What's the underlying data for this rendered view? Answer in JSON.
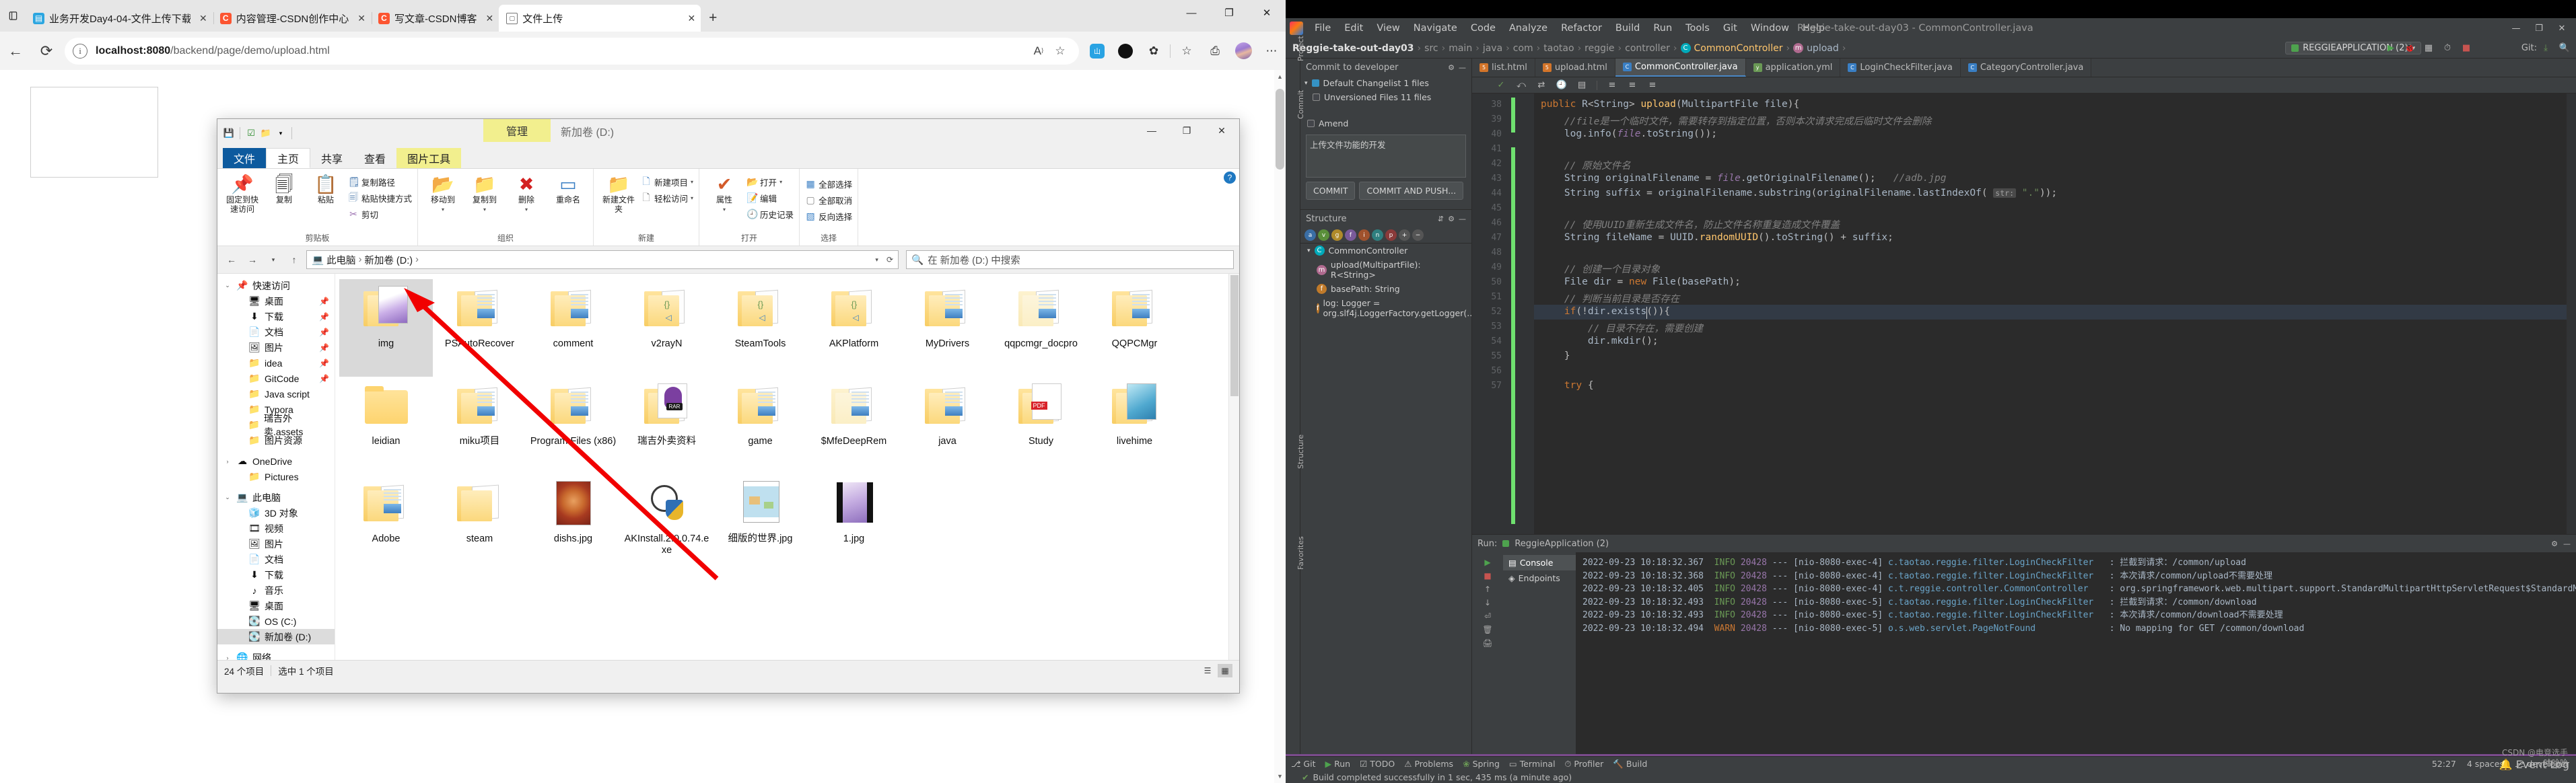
{
  "browser": {
    "app": "Microsoft Edge",
    "tabs": [
      {
        "title": "业务开发Day4-04-文件上传下载",
        "favicon": "blue-doc-icon",
        "active": false
      },
      {
        "title": "内容管理-CSDN创作中心",
        "favicon": "csdn-icon",
        "active": false
      },
      {
        "title": "写文章-CSDN博客",
        "favicon": "csdn-icon",
        "active": false
      },
      {
        "title": "文件上传",
        "favicon": "page-icon",
        "active": true
      }
    ],
    "new_tab_label": "+",
    "close_label": "✕",
    "url_host": "localhost:8080",
    "url_path": "/backend/page/demo/upload.html",
    "window_controls": {
      "minimize": "—",
      "restore": "❐",
      "close": "✕"
    },
    "toolbar_icons": [
      "read-aloud-icon",
      "add-favorite-icon",
      "extension-blue-icon",
      "extension-black-icon",
      "collections-icon",
      "favorites-icon",
      "add-collection-icon",
      "profile-avatar",
      "settings-more-icon"
    ]
  },
  "explorer": {
    "quick_access_icons": [
      "save-icon",
      "properties-icon",
      "new-folder-icon",
      "customize-dropdown-icon"
    ],
    "context_tab": "管理",
    "context_label": "新加卷 (D:)",
    "window_controls": {
      "minimize": "—",
      "maximize": "❐",
      "close": "✕"
    },
    "tabs": [
      {
        "label": "文件",
        "kind": "file"
      },
      {
        "label": "主页",
        "kind": "selected"
      },
      {
        "label": "共享",
        "kind": "normal"
      },
      {
        "label": "查看",
        "kind": "normal"
      },
      {
        "label": "图片工具",
        "kind": "context"
      }
    ],
    "ribbon": [
      {
        "title": "剪贴板",
        "big": [
          {
            "label": "固定到快速访问",
            "glyph": "📌"
          },
          {
            "label": "复制",
            "glyph": "📄"
          },
          {
            "label": "粘贴",
            "glyph": "📋"
          }
        ],
        "small": [
          {
            "label": "复制路径",
            "glyph": "🗐"
          },
          {
            "label": "粘贴快捷方式",
            "glyph": "🗒"
          },
          {
            "label": "剪切",
            "glyph": "✂"
          }
        ]
      },
      {
        "title": "组织",
        "big": [
          {
            "label": "移动到",
            "glyph": "📁",
            "dropdown": true
          },
          {
            "label": "复制到",
            "glyph": "📁",
            "dropdown": true
          },
          {
            "label": "删除",
            "glyph": "✖",
            "dropdown": true
          },
          {
            "label": "重命名",
            "glyph": "▭"
          }
        ],
        "small": []
      },
      {
        "title": "新建",
        "big": [
          {
            "label": "新建文件夹",
            "glyph": "📁"
          }
        ],
        "small": [
          {
            "label": "新建项目",
            "glyph": "🗋",
            "dropdown": true
          },
          {
            "label": "轻松访问",
            "glyph": "🗋",
            "dropdown": true
          }
        ]
      },
      {
        "title": "打开",
        "big": [
          {
            "label": "属性",
            "glyph": "✔",
            "dropdown": true
          }
        ],
        "small": [
          {
            "label": "打开",
            "glyph": "📂",
            "dropdown": true
          },
          {
            "label": "编辑",
            "glyph": "📝"
          },
          {
            "label": "历史记录",
            "glyph": "🕘"
          }
        ]
      },
      {
        "title": "选择",
        "big": [],
        "small": [
          {
            "label": "全部选择",
            "glyph": "▦"
          },
          {
            "label": "全部取消",
            "glyph": "▢"
          },
          {
            "label": "反向选择",
            "glyph": "▧"
          }
        ]
      }
    ],
    "address_buttons": [
      "back-icon",
      "forward-icon",
      "up-icon"
    ],
    "address_path": [
      "此电脑",
      "新加卷 (D:)"
    ],
    "search_placeholder": "在 新加卷 (D:) 中搜索",
    "nav_tree": [
      {
        "label": "快速访问",
        "icon": "pin-icon",
        "level": 1,
        "twisty": "⌄",
        "pinned": false
      },
      {
        "label": "桌面",
        "icon": "desktop-icon",
        "level": 2,
        "pinned": true
      },
      {
        "label": "下载",
        "icon": "download-icon",
        "level": 2,
        "pinned": true
      },
      {
        "label": "文档",
        "icon": "documents-icon",
        "level": 2,
        "pinned": true
      },
      {
        "label": "图片",
        "icon": "pictures-icon",
        "level": 2,
        "pinned": true
      },
      {
        "label": "idea",
        "icon": "folder-icon",
        "level": 2,
        "pinned": true
      },
      {
        "label": "GitCode",
        "icon": "folder-icon",
        "level": 2,
        "pinned": true
      },
      {
        "label": "Java script",
        "icon": "folder-icon",
        "level": 2,
        "pinned": false
      },
      {
        "label": "Typora",
        "icon": "folder-icon",
        "level": 2,
        "pinned": false
      },
      {
        "label": "瑞吉外卖.assets",
        "icon": "folder-icon",
        "level": 2,
        "pinned": false
      },
      {
        "label": "图片资源",
        "icon": "folder-icon",
        "level": 2,
        "pinned": false
      },
      {
        "label": "",
        "icon": "",
        "level": 0,
        "gap": true
      },
      {
        "label": "OneDrive",
        "icon": "cloud-icon",
        "level": 1,
        "twisty": "›"
      },
      {
        "label": "Pictures",
        "icon": "folder-icon",
        "level": 2
      },
      {
        "label": "",
        "icon": "",
        "level": 0,
        "gap": true
      },
      {
        "label": "此电脑",
        "icon": "this-pc-icon",
        "level": 1,
        "twisty": "⌄"
      },
      {
        "label": "3D 对象",
        "icon": "3d-objects-icon",
        "level": 2
      },
      {
        "label": "视频",
        "icon": "videos-icon",
        "level": 2
      },
      {
        "label": "图片",
        "icon": "pictures-icon",
        "level": 2
      },
      {
        "label": "文档",
        "icon": "documents-icon",
        "level": 2
      },
      {
        "label": "下载",
        "icon": "download-icon",
        "level": 2
      },
      {
        "label": "音乐",
        "icon": "music-icon",
        "level": 2
      },
      {
        "label": "桌面",
        "icon": "desktop-icon",
        "level": 2
      },
      {
        "label": "OS (C:)",
        "icon": "drive-icon",
        "level": 2
      },
      {
        "label": "新加卷 (D:)",
        "icon": "drive-icon",
        "level": 2,
        "selected": true
      },
      {
        "label": "",
        "icon": "",
        "level": 0,
        "gap": true
      },
      {
        "label": "网络",
        "icon": "network-icon",
        "level": 1,
        "twisty": "›"
      }
    ],
    "files": [
      {
        "name": "img",
        "type": "folder-picture",
        "selected": true
      },
      {
        "name": "PSAutoRecover",
        "type": "folder-doc"
      },
      {
        "name": "comment",
        "type": "folder-doc"
      },
      {
        "name": "v2rayN",
        "type": "folder-code"
      },
      {
        "name": "SteamTools",
        "type": "folder-code"
      },
      {
        "name": "AKPlatform",
        "type": "folder-code"
      },
      {
        "name": "MyDrivers",
        "type": "folder-doc"
      },
      {
        "name": "qqpcmgr_docpro",
        "type": "folder-doc-pale"
      },
      {
        "name": "QQPCMgr",
        "type": "folder-doc"
      },
      {
        "name": "leidian",
        "type": "folder-plain"
      },
      {
        "name": "miku项目",
        "type": "folder-doc"
      },
      {
        "name": "Program Files (x86)",
        "type": "folder-doc"
      },
      {
        "name": "瑞吉外卖资料",
        "type": "folder-rar"
      },
      {
        "name": "game",
        "type": "folder-doc"
      },
      {
        "name": "$MfeDeepRem",
        "type": "folder-doc-pale"
      },
      {
        "name": "java",
        "type": "folder-doc"
      },
      {
        "name": "Study",
        "type": "folder-pdf"
      },
      {
        "name": "livehime",
        "type": "folder-image"
      },
      {
        "name": "Adobe",
        "type": "folder-doc"
      },
      {
        "name": "steam",
        "type": "folder-white"
      },
      {
        "name": "dishs.jpg",
        "type": "image-food"
      },
      {
        "name": "AKInstall.2.0.0.74.exe",
        "type": "exe-shield"
      },
      {
        "name": "细版的世界.jpg",
        "type": "image-map"
      },
      {
        "name": "1.jpg",
        "type": "image-anime"
      }
    ],
    "status": {
      "count": "24 个项目",
      "selection": "选中 1 个项目",
      "view_icons": [
        "details-view-icon",
        "large-icons-view-icon"
      ]
    }
  },
  "idea": {
    "menu": [
      "File",
      "Edit",
      "View",
      "Navigate",
      "Code",
      "Analyze",
      "Refactor",
      "Build",
      "Run",
      "Tools",
      "Git",
      "Window",
      "Help"
    ],
    "project_title": "Reggie-take-out-day03 - CommonController.java",
    "window_controls": {
      "minimize": "—",
      "maximize": "❐",
      "close": "✕"
    },
    "breadcrumbs": [
      "Reggie-take-out-day03",
      "src",
      "main",
      "java",
      "com",
      "taotao",
      "reggie",
      "controller",
      "CommonController",
      "upload"
    ],
    "run_config": "REGGIEAPPLICATION (2)",
    "git_label": "Git:",
    "commit_pane": {
      "title": "Commit to developer",
      "changelist": "Default Changelist  1 files",
      "unversioned": "Unversioned Files  11 files",
      "amend_label": "Amend",
      "message": "上传文件功能的开发",
      "commit_button": "COMMIT",
      "commit_push_button": "COMMIT AND PUSH..."
    },
    "structure_pane": {
      "title": "Structure",
      "items": [
        {
          "label": "CommonController",
          "icon": "class-icon",
          "level": 1
        },
        {
          "label": "upload(MultipartFile): R<String>",
          "icon": "method-icon",
          "level": 2
        },
        {
          "label": "basePath: String",
          "icon": "field-icon",
          "level": 2
        },
        {
          "label": "log: Logger = org.slf4j.LoggerFactory.getLogger(...)",
          "icon": "field-icon",
          "level": 2
        }
      ]
    },
    "rails": {
      "left": [
        "Project",
        "Commit",
        "Structure",
        "Favorites"
      ],
      "bottom_run": "Run:"
    },
    "editor_tabs": [
      {
        "label": "list.html",
        "icon": "html-icon",
        "active": false
      },
      {
        "label": "upload.html",
        "icon": "html-icon",
        "active": false
      },
      {
        "label": "CommonController.java",
        "icon": "java-icon",
        "active": true
      },
      {
        "label": "application.yml",
        "icon": "yml-icon",
        "active": false
      },
      {
        "label": "LoginCheckFilter.java",
        "icon": "java-icon",
        "active": false
      },
      {
        "label": "CategoryController.java",
        "icon": "java-icon",
        "active": false
      }
    ],
    "code": {
      "first_line_number": 38,
      "caret_line": 52,
      "lines": [
        {
          "n": 38,
          "html": "<span class='k'>public</span> <span class='ty'>R</span>&lt;<span class='ty'>String</span>&gt; <span class='fn'>upload</span>(<span class='ty'>MultipartFile</span> <span class='pl'>file</span>){",
          "text": "public R<String> upload(MultipartFile file){"
        },
        {
          "n": 39,
          "html": "    <span class='cm'>//file是一个临时文件，需要转存到指定位置，否则本次请求完成后临时文件会删除</span>",
          "text": "//file是一个临时文件，需要转存到指定位置，否则本次请求完成后临时文件会删除"
        },
        {
          "n": 40,
          "html": "    <span class='pl'>log</span>.<span class='pl'>info</span>(<span class='fld'>file</span>.<span class='pl'>toString</span>());",
          "text": "log.info(file.toString());"
        },
        {
          "n": 41,
          "html": "",
          "text": ""
        },
        {
          "n": 42,
          "html": "    <span class='cm'>// 原始文件名</span>",
          "text": "// 原始文件名"
        },
        {
          "n": 43,
          "html": "    <span class='ty'>String</span> <span class='pl'>originalFilename</span> = <span class='fld'>file</span>.<span class='pl'>getOriginalFilename</span>();   <span class='cm'>//adb.jpg</span>",
          "text": "String originalFilename = file.getOriginalFilename();   //adb.jpg"
        },
        {
          "n": 44,
          "html": "    <span class='ty'>String</span> <span class='pl'>suffix</span> = <span class='pl'>originalFilename</span>.<span class='pl'>substring</span>(<span class='pl'>originalFilename</span>.<span class='pl'>lastIndexOf</span>( <span class='inlhint'>str:</span> <span class='s'>\".\"</span>));",
          "text": "String suffix = originalFilename.substring(originalFilename.lastIndexOf( str: \".\"));"
        },
        {
          "n": 45,
          "html": "",
          "text": ""
        },
        {
          "n": 46,
          "html": "    <span class='cm'>// 使用UUID重新生成文件名，防止文件名称重复造成文件覆盖</span>",
          "text": "// 使用UUID重新生成文件名，防止文件名称重复造成文件覆盖"
        },
        {
          "n": 47,
          "html": "    <span class='ty'>String</span> <span class='pl'>fileName</span> = <span class='ty'>UUID</span>.<span class='fn'>randomUUID</span>().<span class='pl'>toString</span>() + <span class='pl'>suffix</span>;",
          "text": "String fileName = UUID.randomUUID().toString() + suffix;"
        },
        {
          "n": 48,
          "html": "",
          "text": ""
        },
        {
          "n": 49,
          "html": "    <span class='cm'>// 创建一个目录对象</span>",
          "text": "// 创建一个目录对象"
        },
        {
          "n": 50,
          "html": "    <span class='ty'>File</span> <span class='pl'>dir</span> = <span class='k'>new</span> <span class='ty'>File</span>(<span class='pl'>basePath</span>);",
          "text": "File dir = new File(basePath);"
        },
        {
          "n": 51,
          "html": "    <span class='cm'>// 判断当前目录是否存在</span>",
          "text": "// 判断当前目录是否存在"
        },
        {
          "n": 52,
          "html": "    <span class='k'>if</span>(!<span class='pl'>dir</span>.<span class='pl'>exists</span>()){",
          "text": "if(!dir.exists()){"
        },
        {
          "n": 53,
          "html": "        <span class='cm'>// 目录不存在，需要创建</span>",
          "text": "// 目录不存在，需要创建"
        },
        {
          "n": 54,
          "html": "        <span class='pl'>dir</span>.<span class='pl'>mkdir</span>();",
          "text": "dir.mkdir();"
        },
        {
          "n": 55,
          "html": "    }",
          "text": "}"
        },
        {
          "n": 56,
          "html": "",
          "text": ""
        },
        {
          "n": 57,
          "html": "    <span class='k'>try</span> {",
          "text": "try {"
        }
      ]
    },
    "run_panel": {
      "label": "Run:",
      "config": "ReggieApplication (2)",
      "tabs": [
        {
          "label": "Console",
          "icon": "console-icon",
          "active": true
        },
        {
          "label": "Endpoints",
          "icon": "endpoints-icon",
          "active": false
        }
      ],
      "logs": [
        {
          "ts": "2022-09-23 10:18:32.367",
          "level": "INFO",
          "pid": "20428",
          "thread": "[nio-8080-exec-4]",
          "logger": "c.taotao.reggie.filter.LoginCheckFilter",
          "msg": "拦截到请求：/common/upload"
        },
        {
          "ts": "2022-09-23 10:18:32.368",
          "level": "INFO",
          "pid": "20428",
          "thread": "[nio-8080-exec-4]",
          "logger": "c.taotao.reggie.filter.LoginCheckFilter",
          "msg": "本次请求/common/upload不需要处理"
        },
        {
          "ts": "2022-09-23 10:18:32.405",
          "level": "INFO",
          "pid": "20428",
          "thread": "[nio-8080-exec-4]",
          "logger": "c.t.reggie.controller.CommonController",
          "msg": "org.springframework.web.multipart.support.StandardMultipartHttpServletRequest$StandardMultipartF"
        },
        {
          "ts": "2022-09-23 10:18:32.493",
          "level": "INFO",
          "pid": "20428",
          "thread": "[nio-8080-exec-5]",
          "logger": "c.taotao.reggie.filter.LoginCheckFilter",
          "msg": "拦截到请求：/common/download"
        },
        {
          "ts": "2022-09-23 10:18:32.493",
          "level": "INFO",
          "pid": "20428",
          "thread": "[nio-8080-exec-5]",
          "logger": "c.taotao.reggie.filter.LoginCheckFilter",
          "msg": "本次请求/common/download不需要处理"
        },
        {
          "ts": "2022-09-23 10:18:32.494",
          "level": "WARN",
          "pid": "20428",
          "thread": "[nio-8080-exec-5]",
          "logger": "o.s.web.servlet.PageNotFound",
          "msg": "No mapping for GET /common/download"
        }
      ]
    },
    "status_bar": {
      "items": [
        "Git",
        "Run",
        "TODO",
        "Problems",
        "Spring",
        "Terminal",
        "Profiler",
        "Build"
      ],
      "build_message": "Build completed successfully in 1 sec, 435 ms (a minute ago)",
      "caret_pos": "52:27",
      "indent": "4 spaces",
      "branch": "developer",
      "event_log": "Event Log"
    },
    "watermark": "CSDN @电竞选手\n哈哈哈"
  }
}
